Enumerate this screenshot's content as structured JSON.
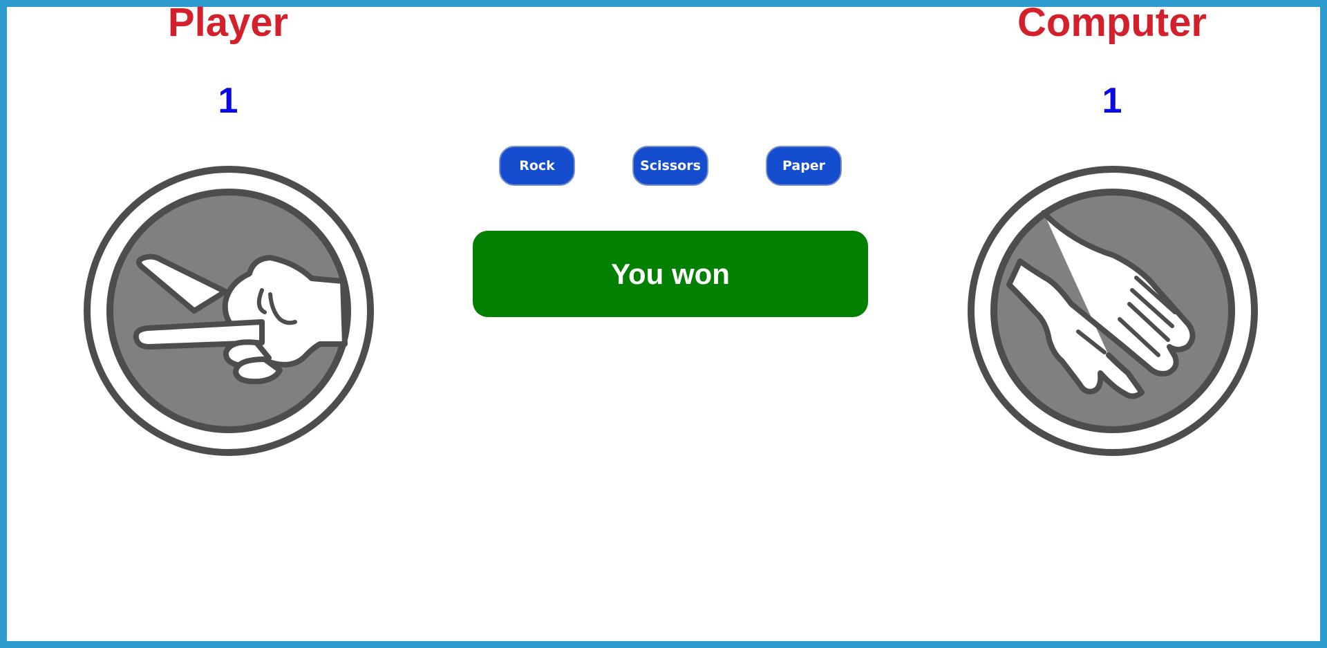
{
  "player": {
    "name": "Player",
    "score": "1",
    "choice_icon": "scissors-hand-icon"
  },
  "computer": {
    "name": "Computer",
    "score": "1",
    "choice_icon": "paper-hand-icon"
  },
  "choices": {
    "rock_label": "Rock",
    "scissors_label": "Scissors",
    "paper_label": "Paper"
  },
  "result": {
    "text": "You won",
    "color": "#028001"
  },
  "colors": {
    "frame": "#2e9ccf",
    "name": "#d4202a",
    "score": "#0a0ae6",
    "button": "#144ecf"
  }
}
